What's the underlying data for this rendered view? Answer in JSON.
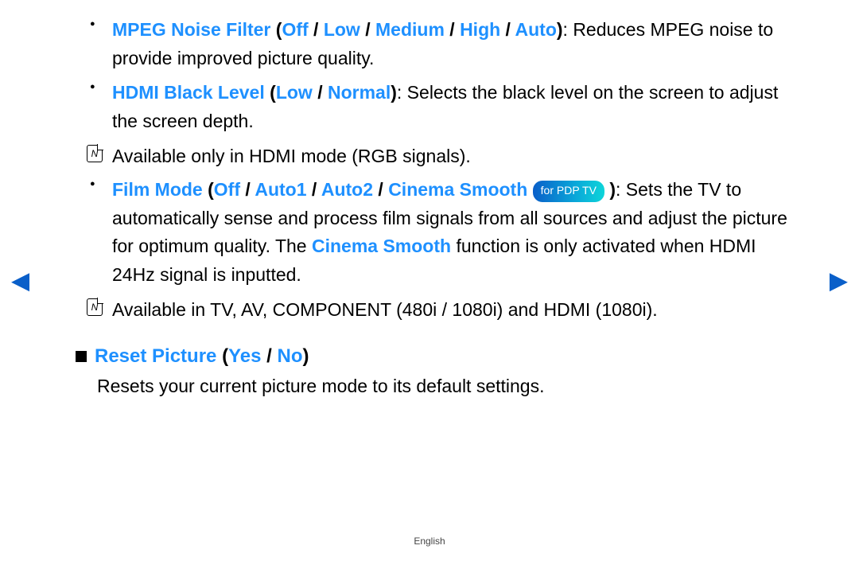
{
  "items": [
    {
      "name": "MPEG Noise Filter",
      "options": [
        "Off",
        "Low",
        "Medium",
        "High",
        "Auto"
      ],
      "desc_after": ": Reduces MPEG noise to provide improved picture quality.",
      "notes": []
    },
    {
      "name": "HDMI Black Level",
      "options": [
        "Low",
        "Normal"
      ],
      "desc_after": ": Selects the black level on the screen to adjust the screen depth.",
      "notes": [
        "Available only in HDMI mode (RGB signals)."
      ]
    },
    {
      "name": "Film Mode",
      "options": [
        "Off",
        "Auto1",
        "Auto2",
        "Cinema Smooth"
      ],
      "pill": "for PDP TV",
      "post_pill_paren": ")",
      "desc_after_parts": [
        {
          "t": ": Sets the TV to automatically sense and process film signals from all sources and adjust the picture for optimum quality. The ",
          "cls": ""
        },
        {
          "t": "Cinema Smooth",
          "cls": "blue"
        },
        {
          "t": " function is only activated when HDMI 24Hz signal is inputted.",
          "cls": ""
        }
      ],
      "notes": [
        "Available in TV, AV, COMPONENT (480i / 1080i) and HDMI (1080i)."
      ]
    }
  ],
  "section": {
    "title": "Reset Picture",
    "options": [
      "Yes",
      "No"
    ],
    "body": "Resets your current picture mode to its default settings."
  },
  "footer": "English",
  "sep": " / ",
  "open_paren": " (",
  "close_paren": ")"
}
